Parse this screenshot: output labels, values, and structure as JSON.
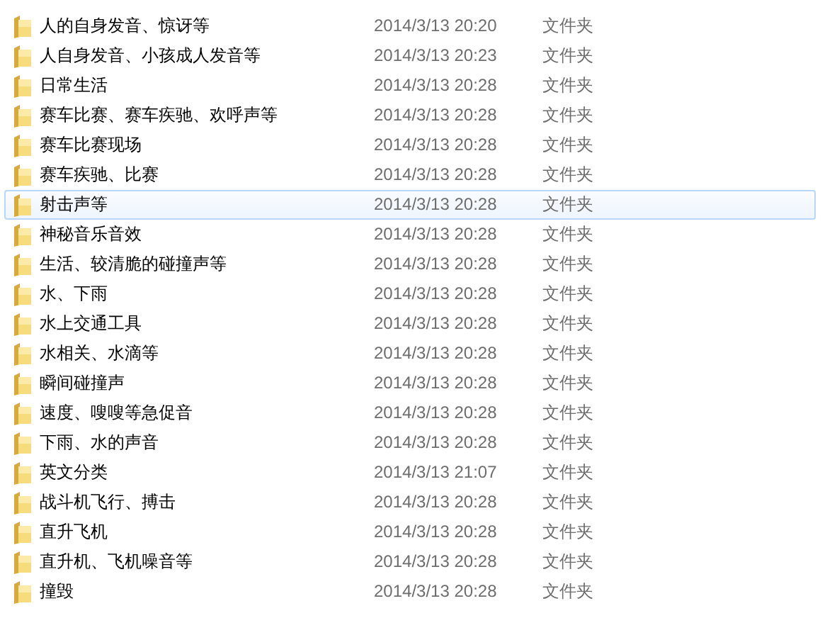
{
  "files": [
    {
      "name": "人的自身发音、惊讶等",
      "modified": "2014/3/13 20:20",
      "type": "文件夹",
      "hovered": false
    },
    {
      "name": "人自身发音、小孩成人发音等",
      "modified": "2014/3/13 20:23",
      "type": "文件夹",
      "hovered": false
    },
    {
      "name": "日常生活",
      "modified": "2014/3/13 20:28",
      "type": "文件夹",
      "hovered": false
    },
    {
      "name": "赛车比赛、赛车疾驰、欢呼声等",
      "modified": "2014/3/13 20:28",
      "type": "文件夹",
      "hovered": false
    },
    {
      "name": "赛车比赛现场",
      "modified": "2014/3/13 20:28",
      "type": "文件夹",
      "hovered": false
    },
    {
      "name": "赛车疾驰、比赛",
      "modified": "2014/3/13 20:28",
      "type": "文件夹",
      "hovered": false
    },
    {
      "name": "射击声等",
      "modified": "2014/3/13 20:28",
      "type": "文件夹",
      "hovered": true
    },
    {
      "name": "神秘音乐音效",
      "modified": "2014/3/13 20:28",
      "type": "文件夹",
      "hovered": false
    },
    {
      "name": "生活、较清脆的碰撞声等",
      "modified": "2014/3/13 20:28",
      "type": "文件夹",
      "hovered": false
    },
    {
      "name": "水、下雨",
      "modified": "2014/3/13 20:28",
      "type": "文件夹",
      "hovered": false
    },
    {
      "name": "水上交通工具",
      "modified": "2014/3/13 20:28",
      "type": "文件夹",
      "hovered": false
    },
    {
      "name": "水相关、水滴等",
      "modified": "2014/3/13 20:28",
      "type": "文件夹",
      "hovered": false
    },
    {
      "name": "瞬间碰撞声",
      "modified": "2014/3/13 20:28",
      "type": "文件夹",
      "hovered": false
    },
    {
      "name": "速度、嗖嗖等急促音",
      "modified": "2014/3/13 20:28",
      "type": "文件夹",
      "hovered": false
    },
    {
      "name": "下雨、水的声音",
      "modified": "2014/3/13 20:28",
      "type": "文件夹",
      "hovered": false
    },
    {
      "name": "英文分类",
      "modified": "2014/3/13 21:07",
      "type": "文件夹",
      "hovered": false
    },
    {
      "name": "战斗机飞行、搏击",
      "modified": "2014/3/13 20:28",
      "type": "文件夹",
      "hovered": false
    },
    {
      "name": "直升飞机",
      "modified": "2014/3/13 20:28",
      "type": "文件夹",
      "hovered": false
    },
    {
      "name": "直升机、飞机噪音等",
      "modified": "2014/3/13 20:28",
      "type": "文件夹",
      "hovered": false
    },
    {
      "name": "撞毁",
      "modified": "2014/3/13 20:28",
      "type": "文件夹",
      "hovered": false
    }
  ]
}
